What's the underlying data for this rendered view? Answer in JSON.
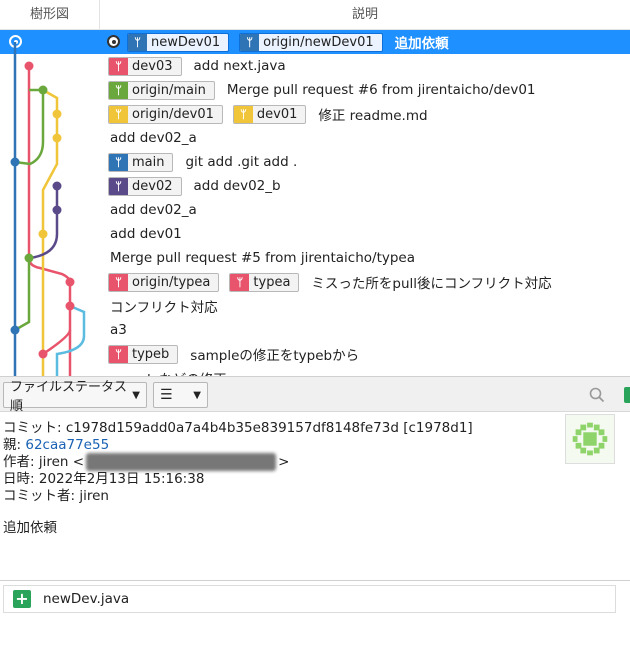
{
  "header": {
    "tree": "樹形図",
    "desc": "説明"
  },
  "colors": {
    "selection": "#1e90ff",
    "branch_blue": "#2f74b5",
    "branch_red": "#e8546b",
    "branch_green": "#6aa83e",
    "branch_yellow": "#f0c53a",
    "branch_purple": "#5b4a8a",
    "branch_cyan": "#5bbbe0",
    "added_green": "#2aa45a"
  },
  "commits": [
    {
      "refs": [
        {
          "label": "newDev01",
          "color": "#2f74b5"
        },
        {
          "label": "origin/newDev01",
          "color": "#2f74b5"
        }
      ],
      "message": "追加依頼"
    },
    {
      "refs": [
        {
          "label": "dev03",
          "color": "#e8546b"
        }
      ],
      "message": "add next.java"
    },
    {
      "refs": [
        {
          "label": "origin/main",
          "color": "#6aa83e"
        }
      ],
      "message": "Merge pull request #6 from jirentaicho/dev01"
    },
    {
      "refs": [
        {
          "label": "origin/dev01",
          "color": "#f0c53a"
        },
        {
          "label": "dev01",
          "color": "#f0c53a"
        }
      ],
      "message": "修正 readme.md"
    },
    {
      "refs": [],
      "message": "add dev02_a"
    },
    {
      "refs": [
        {
          "label": "main",
          "color": "#2f74b5"
        }
      ],
      "message": "git add .git add ."
    },
    {
      "refs": [
        {
          "label": "dev02",
          "color": "#5b4a8a"
        }
      ],
      "message": "add dev02_b"
    },
    {
      "refs": [],
      "message": "add dev02_a"
    },
    {
      "refs": [],
      "message": "add dev01"
    },
    {
      "refs": [],
      "message": "Merge pull request #5 from jirentaicho/typea"
    },
    {
      "refs": [
        {
          "label": "origin/typea",
          "color": "#e8546b"
        },
        {
          "label": "typea",
          "color": "#e8546b"
        }
      ],
      "message": "ミスった所をpull後にコンフリクト対応"
    },
    {
      "refs": [],
      "message": "コンフリクト対応"
    },
    {
      "refs": [],
      "message": "a3"
    },
    {
      "refs": [
        {
          "label": "typeb",
          "color": "#e8546b"
        }
      ],
      "message": "sampleの修正をtypebから"
    },
    {
      "refs": [],
      "message": "sampleなどの修正"
    }
  ],
  "toolbar": {
    "sort_label": "ファイルステータス順",
    "view_icon": "list-icon"
  },
  "detail": {
    "commit_key": "コミット:",
    "commit_value": "c1978d159add0a7a4b4b35e839157df8148fe73d [c1978d1]",
    "parent_key": "親:",
    "parent_value": "62caa77e55",
    "author_key": "作者:",
    "author_value": "jiren <",
    "author_suffix": ">",
    "date_key": "日時:",
    "date_value": "2022年2月13日 15:16:38",
    "committer_key": "コミット者:",
    "committer_value": "jiren",
    "message": "追加依頼"
  },
  "files": [
    {
      "name": "newDev.java",
      "status_icon": "plus-icon"
    }
  ]
}
